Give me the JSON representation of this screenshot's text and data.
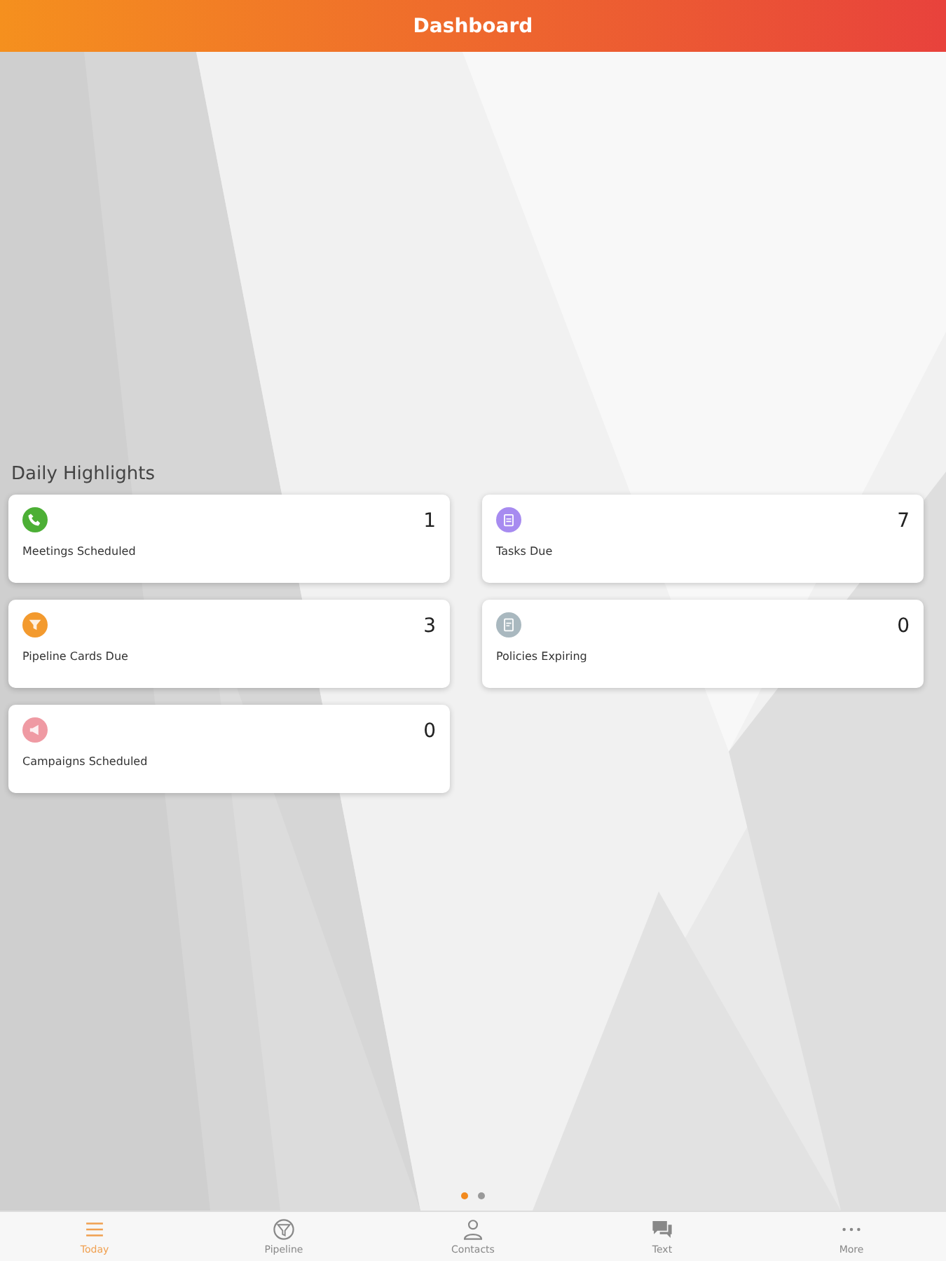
{
  "header": {
    "title": "Dashboard"
  },
  "section": {
    "title": "Daily Highlights"
  },
  "highlights": [
    {
      "label": "Meetings Scheduled",
      "count": "1",
      "kind": "phone",
      "color": "#4caf35"
    },
    {
      "label": "Tasks Due",
      "count": "7",
      "kind": "task",
      "color": "#a78bf0"
    },
    {
      "label": "Pipeline Cards Due",
      "count": "3",
      "kind": "pipeline",
      "color": "#f39a2e"
    },
    {
      "label": "Policies Expiring",
      "count": "0",
      "kind": "policy",
      "color": "#a9b8bf"
    },
    {
      "label": "Campaigns Scheduled",
      "count": "0",
      "kind": "campaign",
      "color": "#ef9aa3"
    }
  ],
  "pages": [
    {
      "selected": true
    },
    {
      "selected": false
    }
  ],
  "tabs": [
    {
      "label": "Today",
      "kind": "list",
      "selected": true
    },
    {
      "label": "Pipeline",
      "kind": "pipeline",
      "selected": false
    },
    {
      "label": "Contacts",
      "kind": "person",
      "selected": false
    },
    {
      "label": "Text",
      "kind": "chat",
      "selected": false
    },
    {
      "label": "More",
      "kind": "more",
      "selected": false
    }
  ]
}
